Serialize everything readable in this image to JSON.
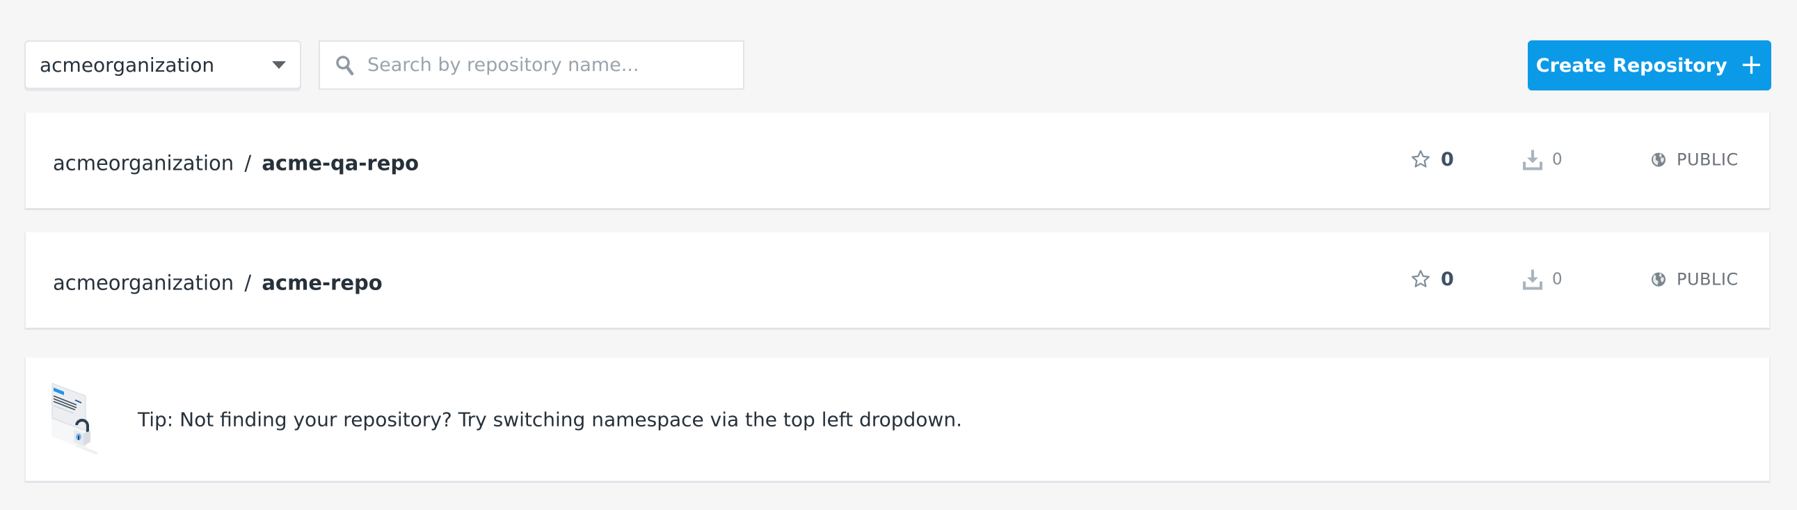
{
  "toolbar": {
    "namespace_select": {
      "value": "acmeorganization",
      "icon": "chevron-down-icon"
    },
    "search": {
      "placeholder": "Search by repository name...",
      "value": "",
      "icon": "search-icon"
    },
    "create_button": {
      "label": "Create Repository",
      "icon": "plus-icon",
      "color": "#0b9ae8"
    }
  },
  "repositories": [
    {
      "namespace": "acmeorganization",
      "separator": "/",
      "name": "acme-qa-repo",
      "stars": "0",
      "pulls": "0",
      "visibility": "PUBLIC",
      "star_icon": "star-outline-icon",
      "pull_icon": "download-icon",
      "visibility_icon": "globe-icon"
    },
    {
      "namespace": "acmeorganization",
      "separator": "/",
      "name": "acme-repo",
      "stars": "0",
      "pulls": "0",
      "visibility": "PUBLIC",
      "star_icon": "star-outline-icon",
      "pull_icon": "download-icon",
      "visibility_icon": "globe-icon"
    }
  ],
  "tip": {
    "icon": "locked-document-illustration",
    "text": "Tip: Not finding your repository? Try switching namespace via the top left dropdown."
  }
}
